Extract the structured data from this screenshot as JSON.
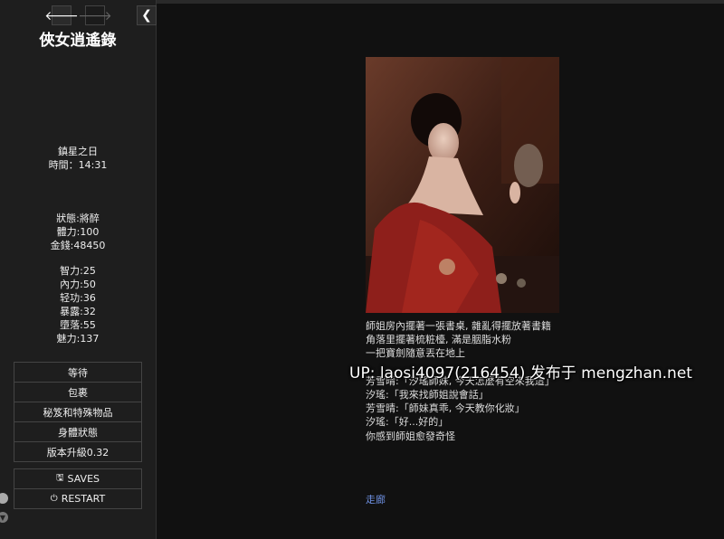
{
  "sidebar": {
    "title": "俠女逍遙錄",
    "nav": {
      "back_icon": "arrow-left-icon",
      "forward_icon": "arrow-right-icon",
      "collapse_icon": "chevron-left-icon"
    },
    "date": "鎮星之日",
    "time": "時間：14:31",
    "status": [
      "狀態:將醉",
      "體力:100",
      "金錢:48450"
    ],
    "attributes": [
      "智力:25",
      "內力:50",
      "轻功:36",
      "暴露:32",
      "墮落:55",
      "魅力:137"
    ],
    "menu": [
      "等待",
      "包裹",
      "秘笈和特殊物品",
      "身體狀態",
      "版本升級0.32"
    ],
    "saves_label": "SAVES",
    "restart_label": "RESTART"
  },
  "passage": {
    "lines": [
      "師姐房內擺著一張書桌, 雜亂得擺放著書籍",
      "角落里擺著梳粧檯, 滿是胭脂水粉",
      "一把寶劍隨意丟在地上",
      "",
      "芳雪晴:「汐瑤師妹, 今天怎麼有空來我這」",
      "汐瑤:「我來找師姐說會話」",
      "芳雪晴:「師妹真乖, 今天教你化妝」",
      "汐瑤:「好...好的」",
      "你感到師姐愈發奇怪"
    ],
    "link": "走廊"
  },
  "watermark": "UP: laosi4097(216454) 发布于 mengzhan.net",
  "colors": {
    "sidebar_bg": "#1e1e1e",
    "main_bg": "#111111",
    "link": "#6d8fe0"
  }
}
